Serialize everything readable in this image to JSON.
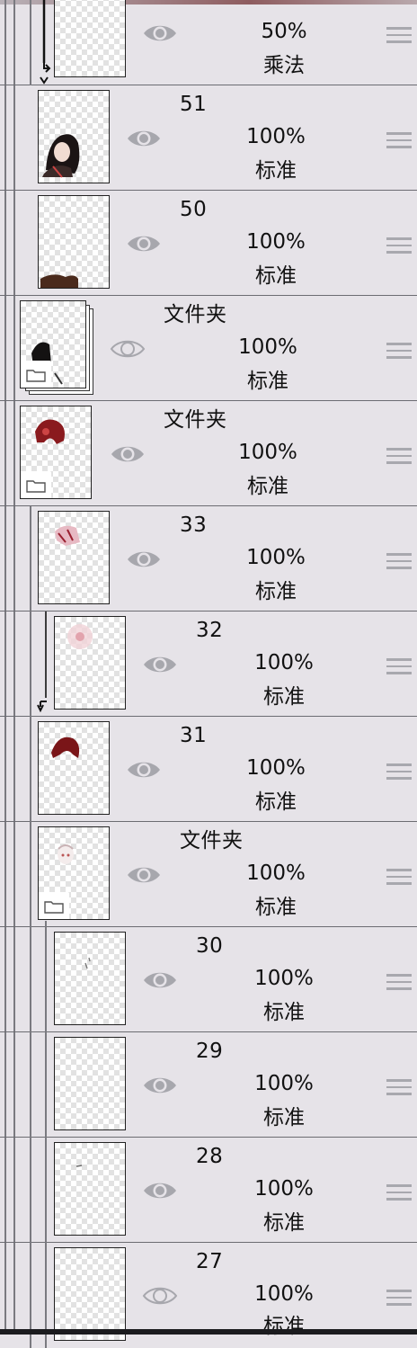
{
  "layers": [
    {
      "name": "",
      "opacity": "50%",
      "blend": "乘法",
      "visible": true,
      "clipped": true
    },
    {
      "name": "51",
      "opacity": "100%",
      "blend": "标准",
      "visible": true
    },
    {
      "name": "50",
      "opacity": "100%",
      "blend": "标准",
      "visible": true
    },
    {
      "name": "文件夹",
      "opacity": "100%",
      "blend": "标准",
      "visible": false,
      "folder": true
    },
    {
      "name": "文件夹",
      "opacity": "100%",
      "blend": "标准",
      "visible": true,
      "folder": true
    },
    {
      "name": "33",
      "opacity": "100%",
      "blend": "标准",
      "visible": true
    },
    {
      "name": "32",
      "opacity": "100%",
      "blend": "标准",
      "visible": true,
      "clipped": true
    },
    {
      "name": "31",
      "opacity": "100%",
      "blend": "标准",
      "visible": true
    },
    {
      "name": "文件夹",
      "opacity": "100%",
      "blend": "标准",
      "visible": true,
      "folder": true
    },
    {
      "name": "30",
      "opacity": "100%",
      "blend": "标准",
      "visible": true
    },
    {
      "name": "29",
      "opacity": "100%",
      "blend": "标准",
      "visible": true
    },
    {
      "name": "28",
      "opacity": "100%",
      "blend": "标准",
      "visible": true
    },
    {
      "name": "27",
      "opacity": "100%",
      "blend": "标准",
      "visible": false
    }
  ],
  "colors": {
    "background": "#e6e3e8",
    "eye": "#a7a7ad",
    "divider": "#6c6c72"
  },
  "icons": {
    "visibility": "eye-icon",
    "hidden": "eye-outline-icon",
    "reorder": "drag-handle-icon",
    "folder": "folder-icon"
  }
}
